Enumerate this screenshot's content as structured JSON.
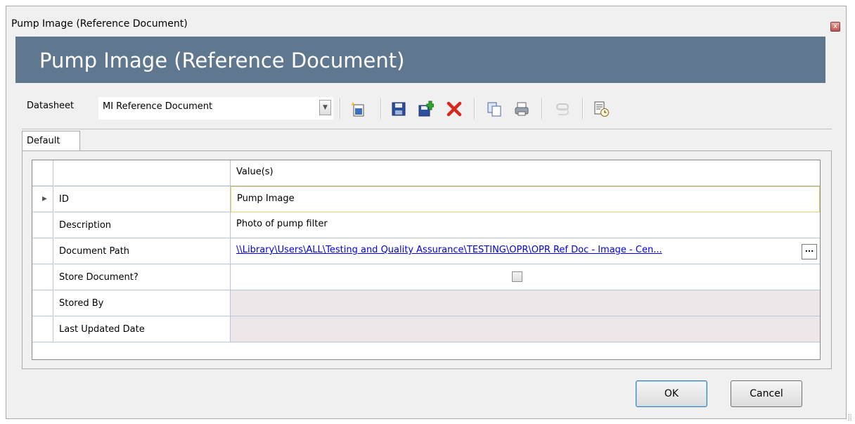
{
  "window": {
    "title": "Pump Image (Reference Document)",
    "close_glyph": "x"
  },
  "header": {
    "title": "Pump Image (Reference Document)"
  },
  "toolbar": {
    "datasheet_label": "Datasheet",
    "datasheet_value": "MI Reference Document",
    "icons": [
      "new-icon",
      "save-icon",
      "save-new-icon",
      "delete-icon",
      "copy-icon",
      "print-icon",
      "attach-icon",
      "history-icon"
    ]
  },
  "tabs": [
    {
      "label": "Default"
    }
  ],
  "grid": {
    "column_header": "Value(s)",
    "rows": [
      {
        "name": "ID",
        "value": "Pump Image"
      },
      {
        "name": "Description",
        "value": "Photo of pump filter"
      },
      {
        "name": "Document Path",
        "value": "\\\\Library\\Users\\ALL\\Testing and Quality Assurance\\TESTING\\OPR\\OPR Ref Doc - Image - Cen..."
      },
      {
        "name": "Store Document?",
        "value": ""
      },
      {
        "name": "Stored By",
        "value": ""
      },
      {
        "name": "Last Updated Date",
        "value": ""
      }
    ],
    "browse_label": "..."
  },
  "buttons": {
    "ok": "OK",
    "cancel": "Cancel"
  },
  "colors": {
    "header_band": "#60788f",
    "link": "#0000ee",
    "disabled_cell": "#ede7ea"
  }
}
